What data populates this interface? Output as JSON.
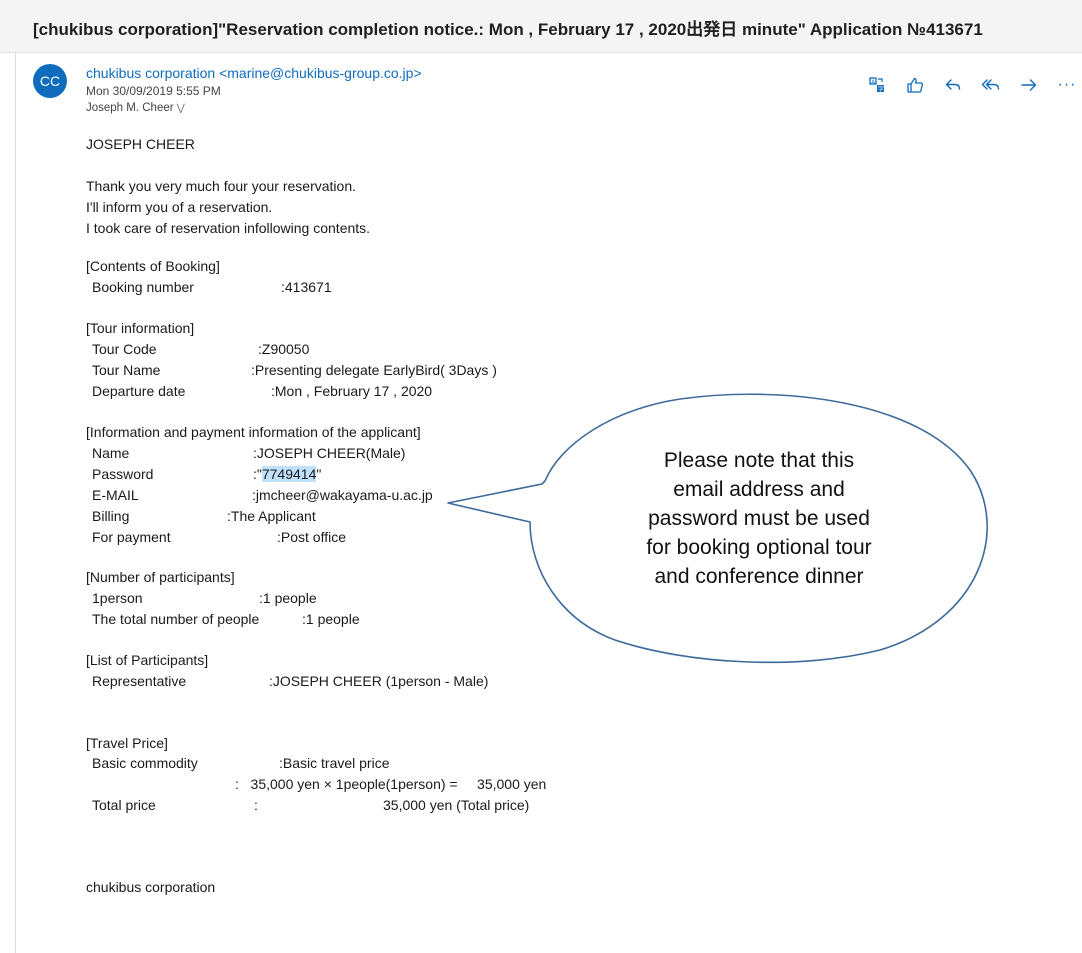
{
  "subject": "[chukibus corporation]\"Reservation completion notice.: Mon , February 17 , 2020出発日 minute\" Application №413671",
  "message": {
    "avatar_initials": "CC",
    "sender": "chukibus corporation <marine@chukibus-group.co.jp>",
    "date": "Mon 30/09/2019 5:55 PM",
    "recipient": "Joseph M. Cheer",
    "actions": [
      "translate-icon",
      "like-icon",
      "reply-icon",
      "reply-all-icon",
      "forward-icon",
      "more-icon"
    ],
    "more_label": "···"
  },
  "body": {
    "greeting": "JOSEPH CHEER",
    "intro": [
      "Thank you very much four your reservation.",
      "I'll inform you of a reservation.",
      "I took care of reservation infollowing contents."
    ],
    "booking": {
      "header": "[Contents of Booking]",
      "number_label": "Booking number",
      "number_value": ":413671"
    },
    "tour": {
      "header": "[Tour information]",
      "code_label": "Tour Code",
      "code_value": ":Z90050",
      "name_label": "Tour Name",
      "name_value": ":Presenting delegate EarlyBird( 3Days )",
      "date_label": "Departure date",
      "date_value": ":Mon , February  17 , 2020"
    },
    "applicant": {
      "header": "[Information and payment information of the applicant]",
      "name_label": "Name",
      "name_value": ":JOSEPH CHEER(Male)",
      "password_label": "Password",
      "password_prefix": ":\"",
      "password_value": "7749414",
      "password_suffix": "\"",
      "email_label": "E-MAIL",
      "email_value": ":jmcheer@wakayama-u.ac.jp",
      "billing_label": "Billing",
      "billing_value": ":The Applicant",
      "payment_label": "For payment",
      "payment_value": ":Post office"
    },
    "participants": {
      "header": "[Number of participants]",
      "person_label": "1person",
      "person_value": ":1 people",
      "total_label": "The total number of people",
      "total_value": ":1 people"
    },
    "list": {
      "header": "[List of Participants]",
      "rep_label": "Representative",
      "rep_value": ":JOSEPH CHEER (1person - Male)"
    },
    "price": {
      "header": "[Travel Price]",
      "basic_label": "Basic commodity",
      "basic_value": ":Basic   travel   price",
      "calc": ":   35,000 yen × 1people(1person) =     35,000 yen",
      "total_label": "Total price",
      "total_colon": ":",
      "total_value": "35,000 yen (Total price)"
    },
    "signature": "chukibus corporation"
  },
  "callout": {
    "lines": [
      "Please note that this",
      "email address and",
      "password must be used",
      "for booking optional tour",
      "and conference dinner"
    ],
    "stroke": "#3e6a9c"
  },
  "colors": {
    "accent": "#0f6cbd",
    "highlight": "#bfe1fb",
    "subject_bar": "#f4f4f4"
  }
}
